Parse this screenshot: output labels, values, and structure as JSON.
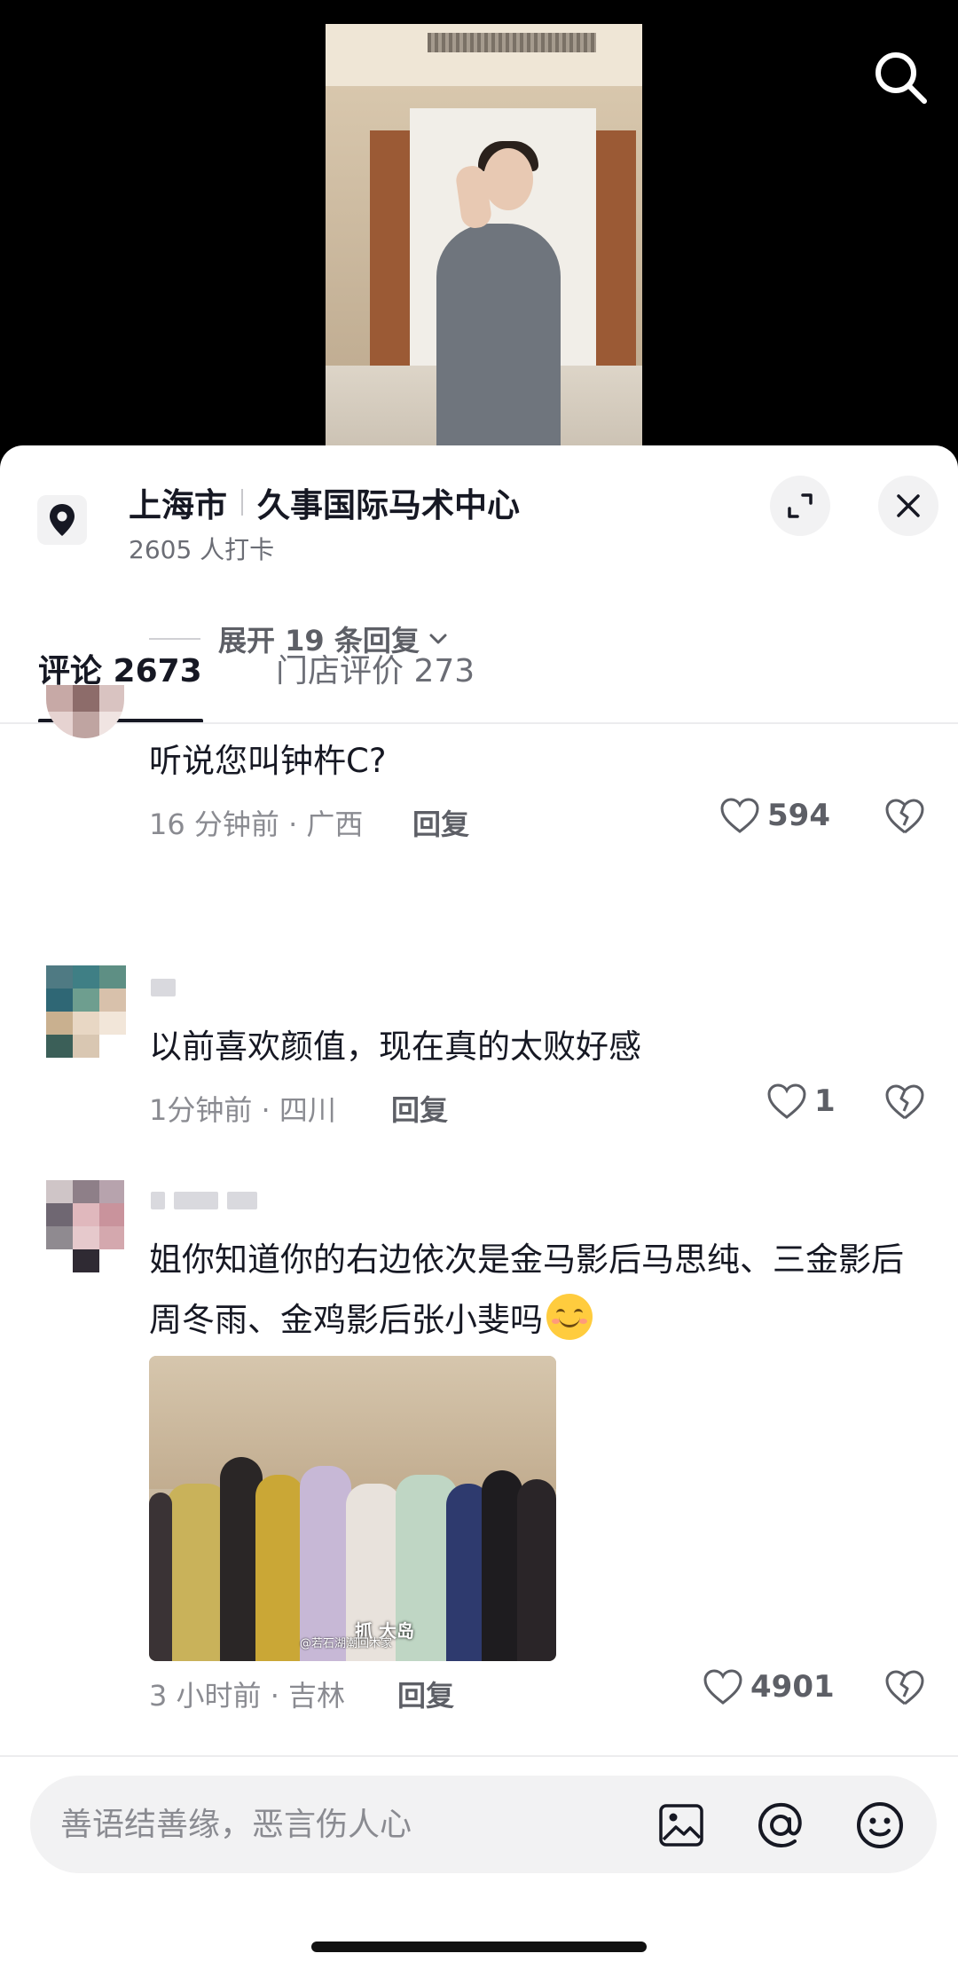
{
  "location": {
    "city": "上海市",
    "venue": "久事国际马术中心",
    "checkins": "2605 人打卡"
  },
  "tabs": [
    {
      "label": "评论 2673",
      "active": true
    },
    {
      "label": "门店评价 273",
      "active": false
    }
  ],
  "comments": [
    {
      "text": "听说您叫钟杵C?",
      "meta": "16 分钟前 · 广西",
      "reply_label": "回复",
      "likes": "594",
      "expand_label": "展开 19 条回复"
    },
    {
      "text": "以前喜欢颜值，现在真的太败好感",
      "meta": "1分钟前 · 四川",
      "reply_label": "回复",
      "likes": "1"
    },
    {
      "text": "姐你知道你的右边依次是金马影后马思纯、三金影后周冬雨、金鸡影后张小斐吗",
      "meta": "3 小时前 · 吉林",
      "reply_label": "回复",
      "likes": "4901",
      "photo_caption": "@若石湖潮回木家",
      "photo_logo": "抓 大岛"
    }
  ],
  "input": {
    "placeholder": "善语结善缘，恶言伤人心"
  },
  "icons": {
    "search": "search-icon",
    "location": "location-pin-icon",
    "expand": "expand-icon",
    "close": "close-icon",
    "like": "heart-icon",
    "dislike": "broken-heart-icon",
    "image": "image-icon",
    "mention": "at-icon",
    "emoji": "emoji-icon"
  },
  "colors": {
    "text_primary": "#161823",
    "text_secondary": "#8a8b91",
    "emoji_yellow": "#ffcc3e"
  }
}
